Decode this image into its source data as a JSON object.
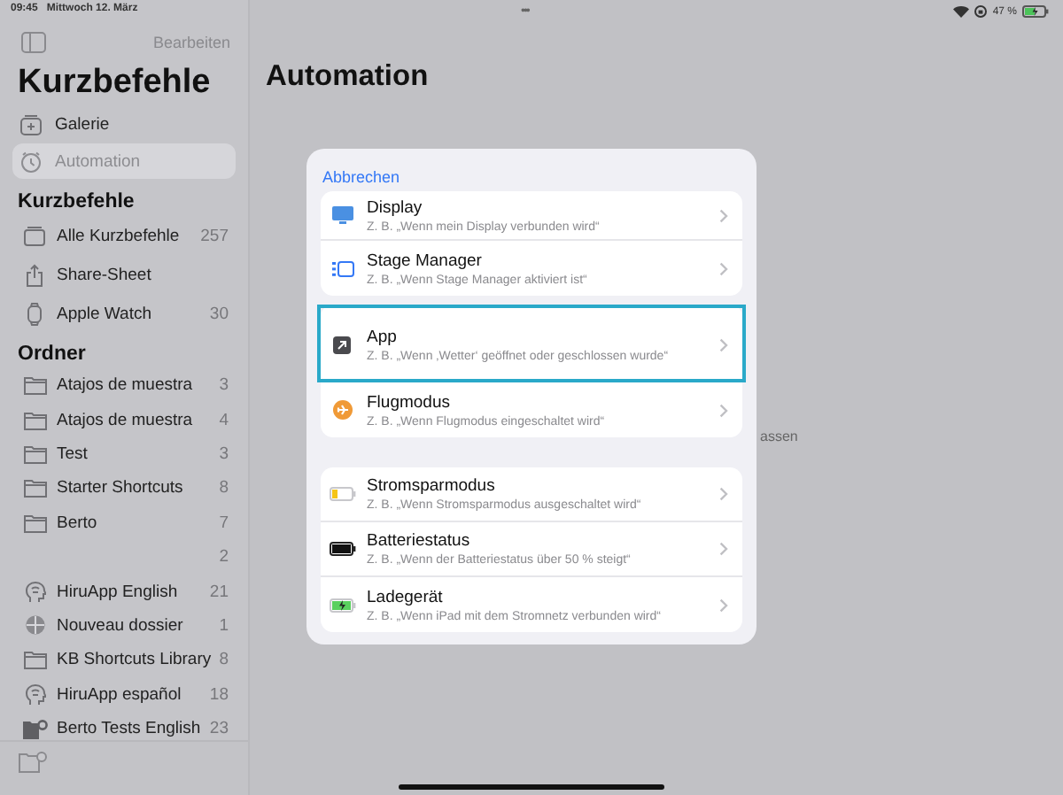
{
  "status_bar": {
    "time": "09:45",
    "date": "Mittwoch 12. März",
    "multitask": "•••",
    "battery": "47 %"
  },
  "sidebar": {
    "edit": "Bearbeiten",
    "title": "Kurzbefehle",
    "top_items": [
      {
        "label": "Galerie",
        "kind": "gallery",
        "selected": false
      },
      {
        "label": "Automation",
        "kind": "clock",
        "selected": true
      }
    ],
    "sections": [
      {
        "title": "Kurzbefehle",
        "items": [
          {
            "label": "Alle Kurzbefehle",
            "count": "257",
            "kind": "stack"
          },
          {
            "label": "Share-Sheet",
            "kind": "share"
          },
          {
            "label": "Apple Watch",
            "count": "30",
            "kind": "watch"
          }
        ]
      },
      {
        "title": "Ordner",
        "items": [
          {
            "label": "Atajos de muestra",
            "count": "3",
            "kind": "folder"
          },
          {
            "label": "Atajos de muestra",
            "count": "4",
            "kind": "folder"
          },
          {
            "label": "Test",
            "count": "3",
            "kind": "folder"
          },
          {
            "label": "Starter Shortcuts",
            "count": "8",
            "kind": "folder"
          },
          {
            "label": "Berto",
            "count": "7",
            "kind": "folder"
          },
          {
            "count": "2",
            "kind": "none"
          },
          {
            "label": "HiruApp English",
            "count": "21",
            "kind": "brain"
          },
          {
            "label": "Nouveau dossier",
            "count": "1",
            "kind": "face"
          },
          {
            "label": "KB Shortcuts Library",
            "count": "8",
            "kind": "folder"
          },
          {
            "label": "HiruApp español",
            "count": "18",
            "kind": "brain"
          },
          {
            "label": "Berto Tests English",
            "count": "23",
            "kind": "folder-gear"
          }
        ]
      }
    ]
  },
  "main": {
    "title": "Automation",
    "background_text": "assen"
  },
  "sheet": {
    "cancel": "Abbrechen",
    "groups": [
      [
        {
          "title": "Display",
          "subtitle": "Z. B. „Wenn mein Display verbunden wird“",
          "kind": "display",
          "selected": false
        },
        {
          "title": "Stage Manager",
          "subtitle": "Z. B. „Wenn Stage Manager aktiviert ist“",
          "kind": "stage",
          "selected": false
        }
      ],
      [
        {
          "title": "App",
          "subtitle": "Z. B. „Wenn ‚Wetter‘ geöffnet oder geschlossen wurde“",
          "kind": "app",
          "selected": true
        },
        {
          "title": "Flugmodus",
          "subtitle": "Z. B. „Wenn Flugmodus eingeschaltet wird“",
          "kind": "plane",
          "selected": false
        }
      ],
      [
        {
          "title": "Stromsparmodus",
          "subtitle": "Z. B. „Wenn Stromsparmodus ausgeschaltet wird“",
          "kind": "lowpower",
          "selected": false
        },
        {
          "title": "Batteriestatus",
          "subtitle": "Z. B. „Wenn der Batteriestatus über 50 % steigt“",
          "kind": "battery",
          "selected": false
        },
        {
          "title": "Ladegerät",
          "subtitle": "Z. B. „Wenn iPad mit dem Stromnetz verbunden wird“",
          "kind": "charger",
          "selected": false
        }
      ]
    ]
  }
}
